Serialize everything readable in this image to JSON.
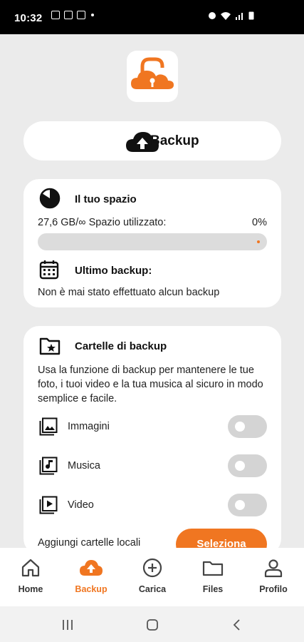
{
  "status_bar": {
    "time": "10:32"
  },
  "brand": {
    "accent": "#f07621",
    "app_icon": "cloud-lock-icon"
  },
  "backup_button": {
    "label": "Backup",
    "icon": "cloud-upload-icon"
  },
  "space_card": {
    "title": "Il tuo spazio",
    "usage_text": "27,6 GB/∞ Spazio utilizzato:",
    "percent": "0%",
    "progress": 0,
    "last_backup_title": "Ultimo backup:",
    "last_backup_text": "Non è mai stato effettuato alcun backup"
  },
  "folders_card": {
    "title": "Cartelle di backup",
    "description": "Usa la funzione di backup per mantenere le tue foto, i tuoi video e la tua musica al sicuro in modo semplice e facile.",
    "items": [
      {
        "label": "Immagini",
        "icon": "image-icon",
        "enabled": false
      },
      {
        "label": "Musica",
        "icon": "music-icon",
        "enabled": false
      },
      {
        "label": "Video",
        "icon": "video-icon",
        "enabled": false
      }
    ],
    "add_local_label": "Aggiungi cartelle locali",
    "select_label": "Seleziona"
  },
  "bottom_nav": {
    "items": [
      {
        "label": "Home",
        "icon": "home-icon",
        "active": false
      },
      {
        "label": "Backup",
        "icon": "cloud-upload-icon",
        "active": true
      },
      {
        "label": "Carica",
        "icon": "plus-circle-icon",
        "active": false
      },
      {
        "label": "Files",
        "icon": "folder-icon",
        "active": false
      },
      {
        "label": "Profilo",
        "icon": "user-icon",
        "active": false
      }
    ]
  }
}
